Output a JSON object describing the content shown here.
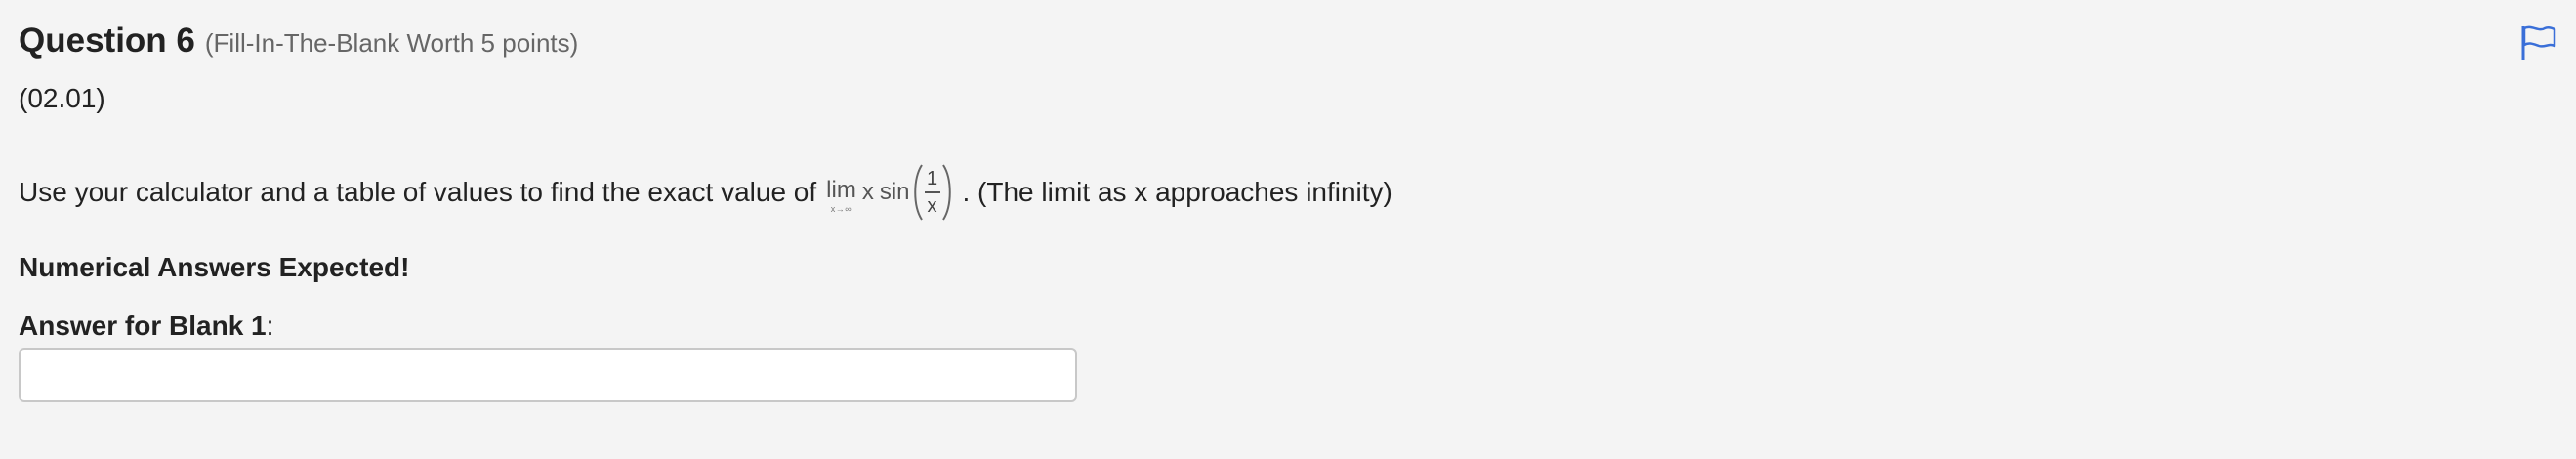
{
  "question": {
    "title": "Question 6",
    "subtitle": "(Fill-In-The-Blank Worth 5 points)",
    "code": "(02.01)",
    "prompt_before": "Use your calculator and a table of values to find the exact value of",
    "prompt_after": ". (The limit as x approaches infinity)",
    "math": {
      "lim": "lim",
      "lim_sub": "x→∞",
      "var": "x",
      "fn": "sin",
      "frac_num": "1",
      "frac_den": "x"
    },
    "numerical_notice": "Numerical Answers Expected!",
    "blank_label": "Answer for Blank 1",
    "blank_colon": ":",
    "answer_value": "",
    "flag_icon": "flag-icon",
    "flag_color": "#3a6fd8"
  }
}
